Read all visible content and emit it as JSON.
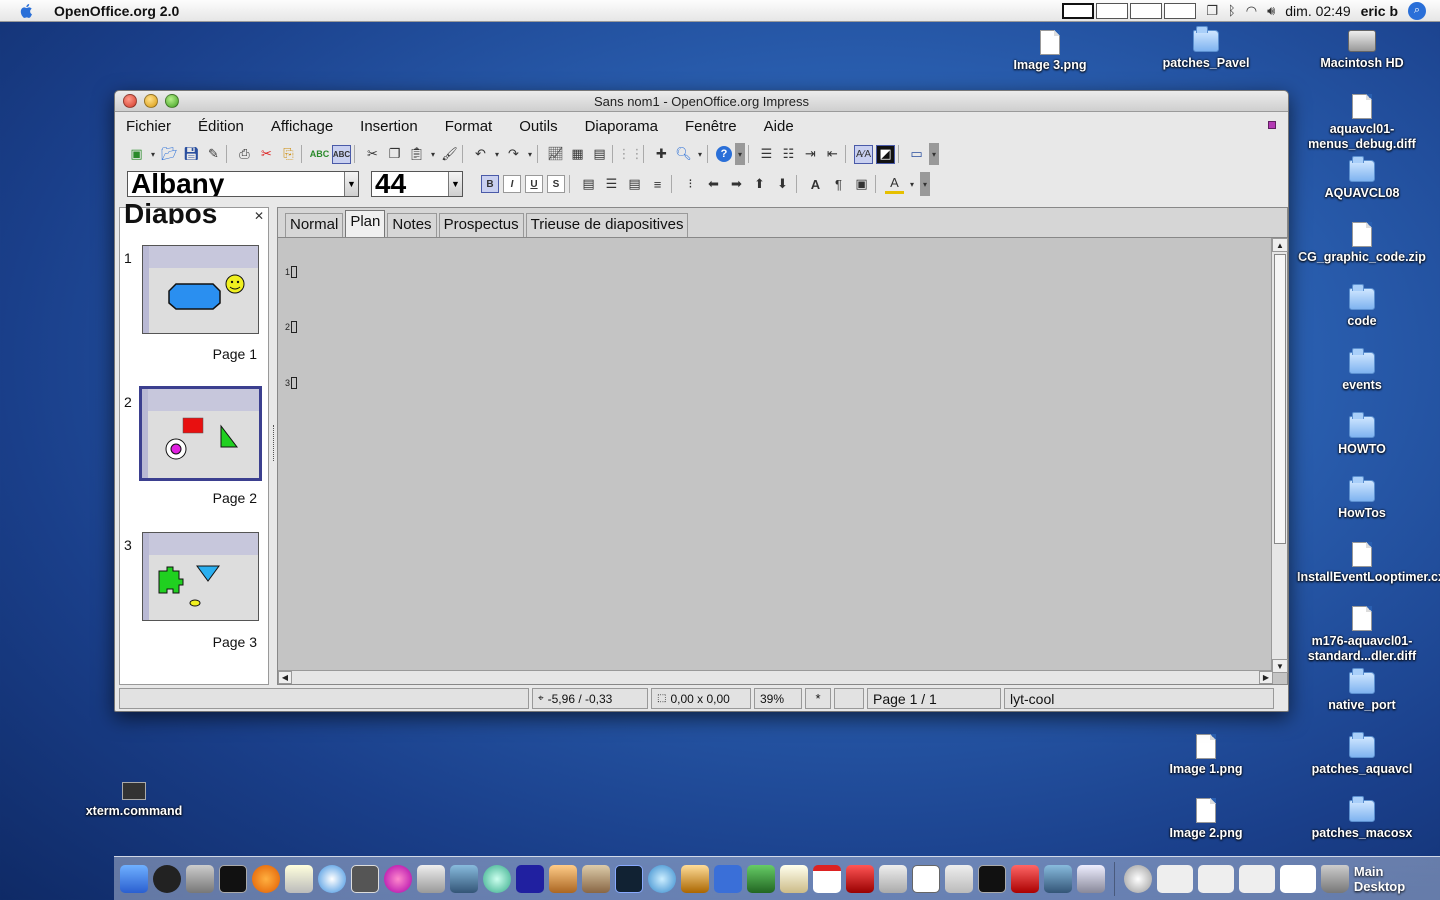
{
  "menubar": {
    "app_name": "OpenOffice.org 2.0",
    "clock": "dim. 02:49",
    "user": "eric b"
  },
  "desktop_icons": [
    {
      "label": "Image 3.png"
    },
    {
      "label": "patches_Pavel"
    },
    {
      "label": "Macintosh HD"
    },
    {
      "label": "aquavcl01-menus_debug.diff"
    },
    {
      "label": "AQUAVCL08"
    },
    {
      "label": "CG_graphic_code.zip"
    },
    {
      "label": "code"
    },
    {
      "label": "events"
    },
    {
      "label": "HOWTO"
    },
    {
      "label": "HowTos"
    },
    {
      "label": "InstallEventLooptimer.cxx"
    },
    {
      "label": "m176-aquavcl01-standard...dler.diff"
    },
    {
      "label": "native_port"
    },
    {
      "label": "Image 1.png"
    },
    {
      "label": "patches_aquavcl"
    },
    {
      "label": "Image 2.png"
    },
    {
      "label": "patches_macosx"
    },
    {
      "label": "xterm.command"
    }
  ],
  "window": {
    "title": "Sans nom1 - OpenOffice.org Impress",
    "menu": [
      "Fichier",
      "Édition",
      "Affichage",
      "Insertion",
      "Format",
      "Outils",
      "Diaporama",
      "Fenêtre",
      "Aide"
    ],
    "font_name": "Albany",
    "font_size": "44",
    "slides_pane": {
      "title": "Diapos",
      "slides": [
        {
          "number": "1",
          "label": "Page 1"
        },
        {
          "number": "2",
          "label": "Page 2"
        },
        {
          "number": "3",
          "label": "Page 3"
        }
      ]
    },
    "tabs": [
      "Normal",
      "Plan",
      "Notes",
      "Prospectus",
      "Trieuse de diapositives"
    ],
    "outline_numbers": [
      "1",
      "2",
      "3"
    ],
    "status": {
      "position": "-5,96 / -0,33",
      "size": "0,00 x 0,00",
      "zoom": "39%",
      "modified": "*",
      "page": "Page 1 / 1",
      "layout": "lyt-cool"
    }
  },
  "dock": {
    "label": "Main Desktop"
  },
  "colors": {
    "accent": "#3b3f8f",
    "selection": "#c9d0f0"
  }
}
